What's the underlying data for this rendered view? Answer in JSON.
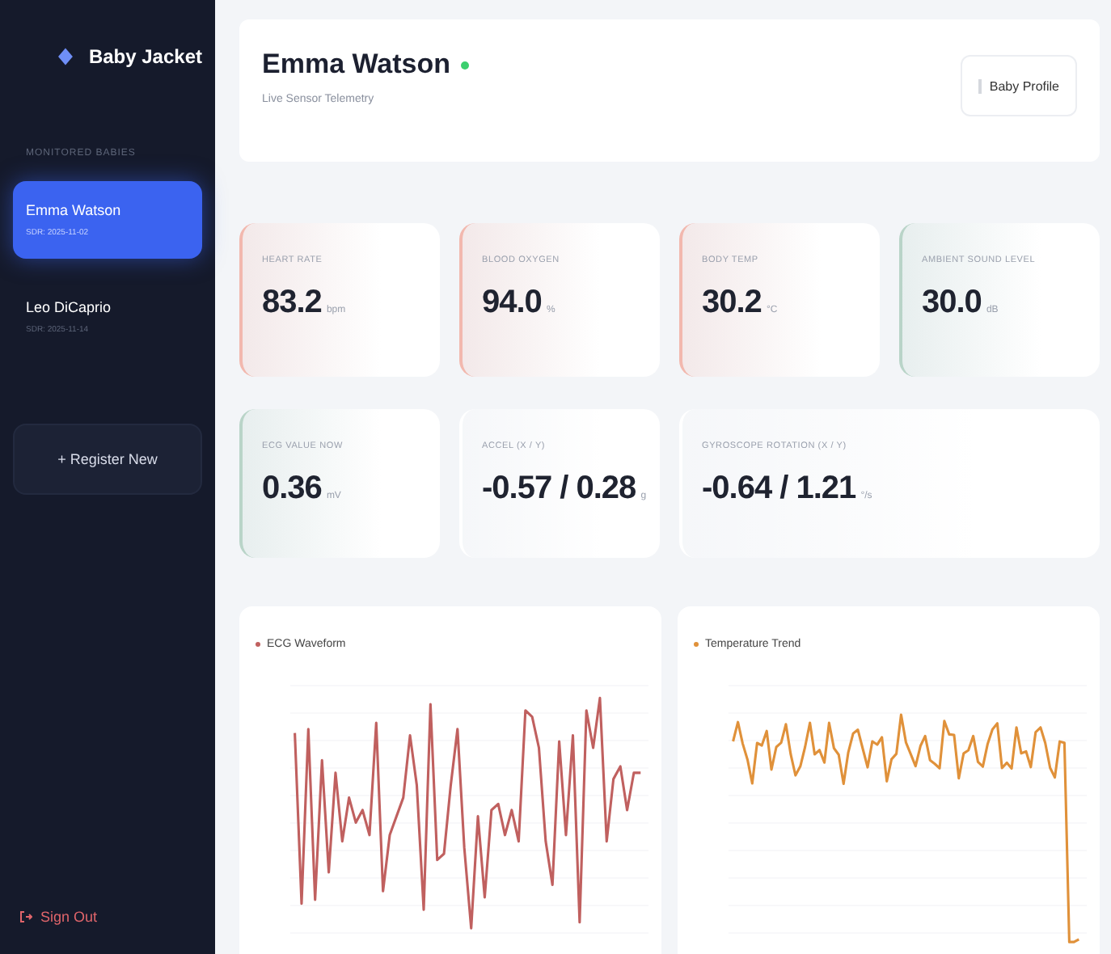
{
  "sidebar": {
    "brand": "Baby Jacket",
    "section_label": "MONITORED BABIES",
    "items": [
      {
        "name": "Emma Watson",
        "id": "SDR: 2025-11-02",
        "selected": true
      },
      {
        "name": "Leo DiCaprio",
        "id": "SDR: 2025-11-14",
        "selected": false
      }
    ],
    "register_button": "+ Register New",
    "sign_out": "Sign Out"
  },
  "header": {
    "title": "Emma Watson",
    "online": true,
    "subtitle": "Live Sensor Telemetry",
    "profile_button": "Baby Profile"
  },
  "metrics": [
    {
      "label": "HEART RATE",
      "value": "83.2",
      "unit": "bpm",
      "color": "#f2b8ae"
    },
    {
      "label": "BLOOD OXYGEN",
      "value": "94.0",
      "unit": "%",
      "color": "#f2b8ae"
    },
    {
      "label": "BODY TEMP",
      "value": "30.2",
      "unit": "°C",
      "color": "#f2b8ae"
    },
    {
      "label": "AMBIENT SOUND LEVEL",
      "value": "30.0",
      "unit": "dB",
      "color": "#b9d4c8"
    },
    {
      "label": "ECG VALUE NOW",
      "value": "0.36",
      "unit": "mV",
      "color": "#b9d4c8"
    },
    {
      "label": "ACCEL (X / Y)",
      "value": "-0.57 / 0.28",
      "unit": "g",
      "color": "#ffffff"
    },
    {
      "label": "GYROSCOPE ROTATION (X / Y)",
      "value": "-0.64 / 1.21",
      "unit": "°/s",
      "color": "#ffffff"
    }
  ],
  "charts": [
    {
      "title": "ECG Waveform",
      "kind": "ecg",
      "color": "#c0605f"
    },
    {
      "title": "Temperature Trend",
      "kind": "temp",
      "color": "#e0913a"
    }
  ]
}
